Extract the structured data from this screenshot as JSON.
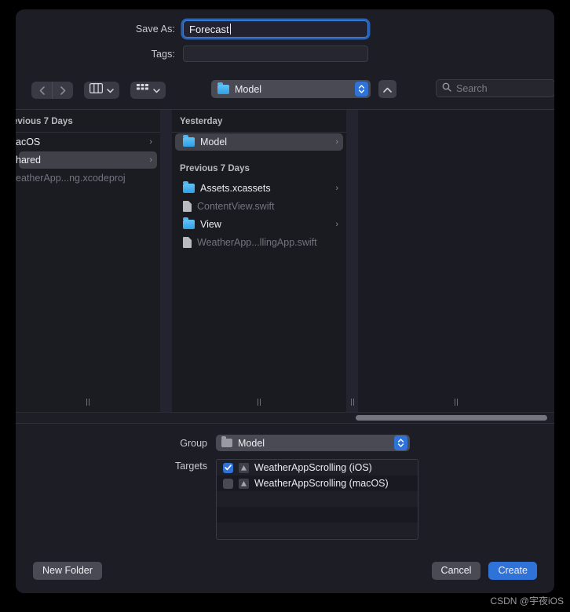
{
  "dialog": {
    "save_as_label": "Save As:",
    "save_as_value": "Forecast",
    "tags_label": "Tags:",
    "tags_value": ""
  },
  "toolbar": {
    "back_icon": "chevron-left-icon",
    "forward_icon": "chevron-right-icon",
    "column_view_icon": "column-view-icon",
    "icon_view_icon": "icon-view-icon",
    "path_label": "Model",
    "up_icon": "chevron-up-icon",
    "search_icon": "search-icon",
    "search_placeholder": "Search"
  },
  "sidebar": {
    "header": "evious 7 Days",
    "items": [
      {
        "label": "acOS",
        "selected": false,
        "dim": false,
        "chevron": "›"
      },
      {
        "label": "hared",
        "selected": true,
        "dim": false,
        "chevron": "›"
      },
      {
        "label": "eatherApp...ng.xcodeproj",
        "selected": false,
        "dim": true,
        "chevron": ""
      }
    ]
  },
  "files": {
    "sections": [
      {
        "header": "Yesterday",
        "items": [
          {
            "label": "Model",
            "icon": "folder",
            "selected": true,
            "dim": false,
            "chevron": "›"
          }
        ]
      },
      {
        "header": "Previous 7 Days",
        "items": [
          {
            "label": "Assets.xcassets",
            "icon": "folder",
            "selected": false,
            "dim": false,
            "chevron": "›"
          },
          {
            "label": "ContentView.swift",
            "icon": "doc",
            "selected": false,
            "dim": true,
            "chevron": ""
          },
          {
            "label": "View",
            "icon": "folder",
            "selected": false,
            "dim": false,
            "chevron": "›"
          },
          {
            "label": "WeatherApp...llingApp.swift",
            "icon": "doc",
            "selected": false,
            "dim": true,
            "chevron": ""
          }
        ]
      }
    ]
  },
  "bottom": {
    "group_label": "Group",
    "group_value": "Model",
    "targets_label": "Targets",
    "targets": [
      {
        "label": "WeatherAppScrolling (iOS)",
        "checked": true
      },
      {
        "label": "WeatherAppScrolling (macOS)",
        "checked": false
      }
    ]
  },
  "footer": {
    "new_folder_label": "New Folder",
    "cancel_label": "Cancel",
    "create_label": "Create"
  },
  "watermark": "CSDN @宇夜iOS",
  "colors": {
    "accent": "#2f73d8",
    "focus_ring": "#3f7fd4",
    "folder_blue": "#2e9fe8",
    "dialog_bg": "#1d1d25"
  }
}
